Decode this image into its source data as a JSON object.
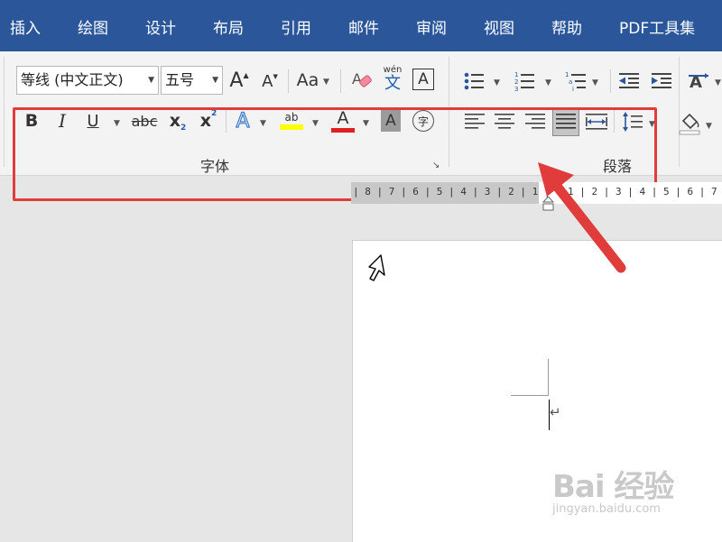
{
  "tabs": [
    "插入",
    "绘图",
    "设计",
    "布局",
    "引用",
    "邮件",
    "审阅",
    "视图",
    "帮助",
    "PDF工具集"
  ],
  "font_group": {
    "label": "字体",
    "font_name": "等线 (中文正文)",
    "font_size": "五号",
    "grow_font_glyph": "A",
    "shrink_font_glyph": "A",
    "change_case_glyph": "Aa",
    "phonetic_top": "wén",
    "phonetic_bottom": "文",
    "char_border_glyph": "A",
    "bold_glyph": "B",
    "italic_glyph": "I",
    "underline_glyph": "U",
    "strike_glyph": "abc",
    "subscript_glyph": "x",
    "subscript_sub": "2",
    "superscript_glyph": "x",
    "superscript_sup": "2",
    "text_effect_glyph": "A",
    "highlight_glyph": "ab",
    "font_color_glyph": "A",
    "char_shading_glyph": "A",
    "enclose_char_glyph": "字"
  },
  "paragraph_group": {
    "label": "段落"
  },
  "ruler": {
    "left_marks": "| 8 | 7 | 6 | 5 | 4 | 3 | 2 | 1 |",
    "right_marks": "1 | 2 | 3 | 4 | 5 | 6 | 7"
  },
  "document": {
    "paragraph_mark": "↵"
  },
  "watermark": {
    "title": "Bai 经验",
    "url": "jingyan.baidu.com"
  },
  "colors": {
    "tabbar": "#2b579a",
    "highlight_yellow": "#ffff00",
    "font_red": "#e02020",
    "annotation_red": "#e03c3c"
  }
}
